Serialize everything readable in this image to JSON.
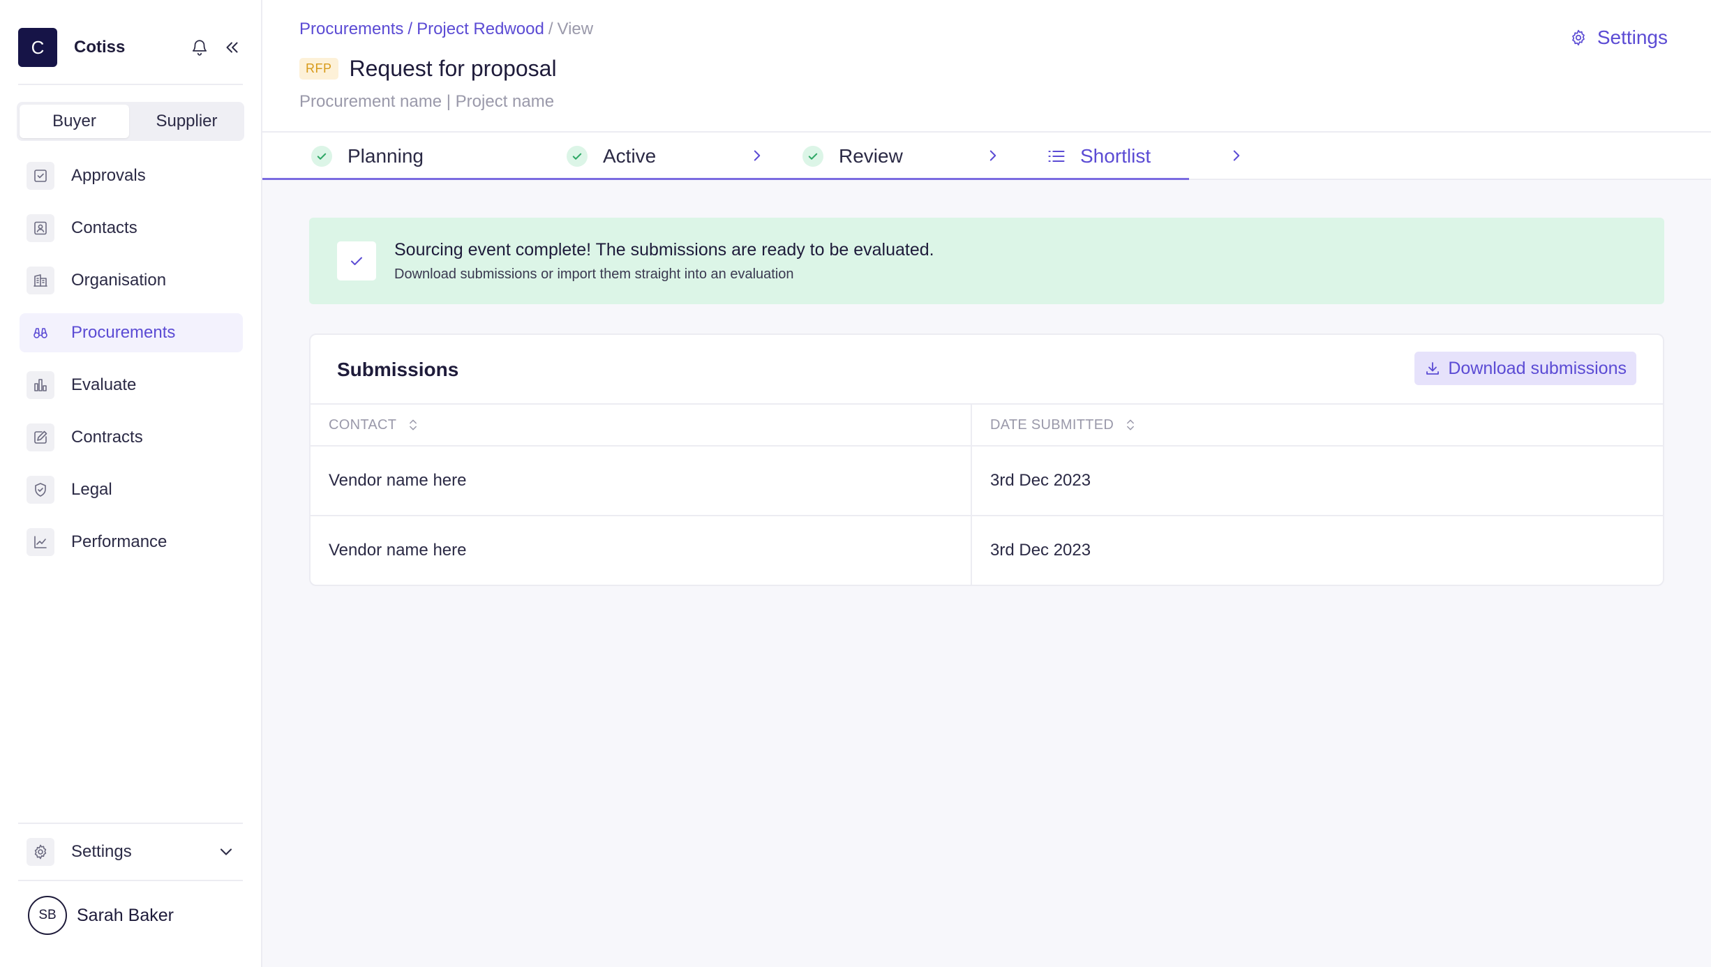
{
  "brand": {
    "logo_letter": "C",
    "name": "Cotiss"
  },
  "role_toggle": {
    "buyer": "Buyer",
    "supplier": "Supplier",
    "selected": "Buyer"
  },
  "nav": {
    "items": [
      {
        "label": "Approvals",
        "icon": "check-square-icon"
      },
      {
        "label": "Contacts",
        "icon": "contact-card-icon"
      },
      {
        "label": "Organisation",
        "icon": "building-icon"
      },
      {
        "label": "Procurements",
        "icon": "binoculars-icon",
        "active": true
      },
      {
        "label": "Evaluate",
        "icon": "bar-chart-icon"
      },
      {
        "label": "Contracts",
        "icon": "edit-document-icon"
      },
      {
        "label": "Legal",
        "icon": "shield-check-icon"
      },
      {
        "label": "Performance",
        "icon": "line-chart-icon"
      }
    ]
  },
  "sidebar_settings": {
    "label": "Settings"
  },
  "user": {
    "initials": "SB",
    "name": "Sarah Baker"
  },
  "breadcrumb": {
    "procurements": "Procurements",
    "project": "Project Redwood",
    "current": "View",
    "separator": "/"
  },
  "header": {
    "badge": "RFP",
    "title": "Request for proposal",
    "subtitle": "Procurement name | Project name",
    "settings_label": "Settings"
  },
  "tabs": [
    {
      "label": "Planning",
      "state": "complete"
    },
    {
      "label": "Active",
      "state": "complete"
    },
    {
      "label": "Review",
      "state": "complete"
    },
    {
      "label": "Shortlist",
      "state": "current"
    }
  ],
  "alert": {
    "title": "Sourcing event complete! The submissions are ready to be evaluated.",
    "subtitle": "Download submissions or import them straight into an evaluation"
  },
  "submissions": {
    "title": "Submissions",
    "download_label": "Download submissions",
    "columns": [
      "CONTACT",
      "DATE SUBMITTED"
    ],
    "rows": [
      {
        "contact": "Vendor name here",
        "date": "3rd Dec 2023"
      },
      {
        "contact": "Vendor name here",
        "date": "3rd Dec 2023"
      }
    ]
  },
  "colors": {
    "accent": "#5b4bd4",
    "brand_dark": "#161447",
    "success_bg": "#dcf5e7",
    "success": "#2fa866",
    "badge_bg": "#fdf1d8",
    "badge_text": "#d79a1a"
  }
}
